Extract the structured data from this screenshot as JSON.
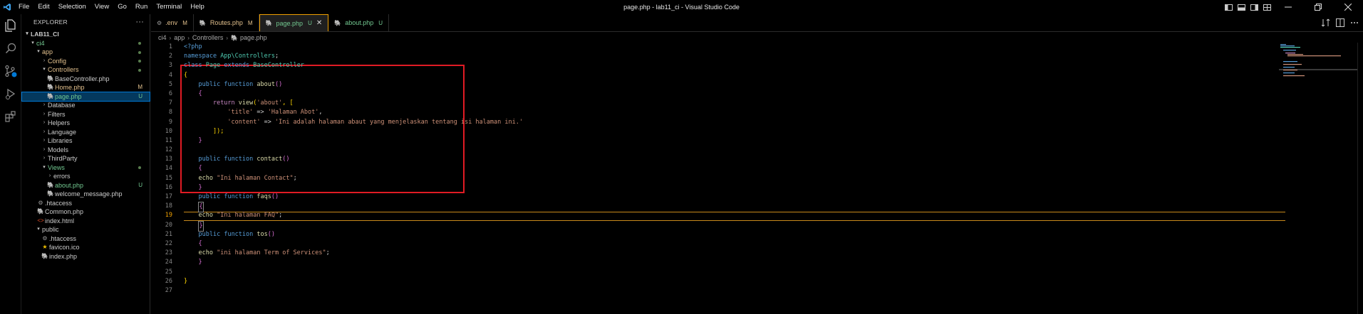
{
  "titlebar": {
    "menu": [
      "File",
      "Edit",
      "Selection",
      "View",
      "Go",
      "Run",
      "Terminal",
      "Help"
    ],
    "title": "page.php - lab11_ci - Visual Studio Code"
  },
  "explorer": {
    "header": "EXPLORER",
    "more": "···",
    "root": "LAB11_CI",
    "items": [
      {
        "label": "ci4",
        "status": "dot"
      },
      {
        "label": "app",
        "status": "dot"
      },
      {
        "label": "Config",
        "status": "dot"
      },
      {
        "label": "Controllers",
        "status": "dot"
      },
      {
        "label": "BaseController.php",
        "status": ""
      },
      {
        "label": "Home.php",
        "status": "M"
      },
      {
        "label": "page.php",
        "status": "U"
      },
      {
        "label": "Database",
        "status": ""
      },
      {
        "label": "Filters",
        "status": ""
      },
      {
        "label": "Helpers",
        "status": ""
      },
      {
        "label": "Language",
        "status": ""
      },
      {
        "label": "Libraries",
        "status": ""
      },
      {
        "label": "Models",
        "status": ""
      },
      {
        "label": "ThirdParty",
        "status": ""
      },
      {
        "label": "Views",
        "status": "dot"
      },
      {
        "label": "errors",
        "status": ""
      },
      {
        "label": "about.php",
        "status": "U"
      },
      {
        "label": "welcome_message.php",
        "status": ""
      },
      {
        "label": ".htaccess",
        "status": ""
      },
      {
        "label": "Common.php",
        "status": ""
      },
      {
        "label": "index.html",
        "status": ""
      },
      {
        "label": "public",
        "status": ""
      },
      {
        "label": ".htaccess",
        "status": ""
      },
      {
        "label": "favicon.ico",
        "status": ""
      },
      {
        "label": "index.php",
        "status": ""
      }
    ]
  },
  "tabs": [
    {
      "label": ".env",
      "status": "M"
    },
    {
      "label": "Routes.php",
      "status": "M"
    },
    {
      "label": "page.php",
      "status": "U",
      "close": "✕"
    },
    {
      "label": "about.php",
      "status": "U"
    }
  ],
  "breadcrumb": [
    "ci4",
    "app",
    "Controllers",
    "page.php"
  ],
  "editor": {
    "line_numbers": [
      "1",
      "2",
      "3",
      "4",
      "5",
      "6",
      "7",
      "8",
      "9",
      "10",
      "11",
      "12",
      "13",
      "14",
      "15",
      "16",
      "17",
      "18",
      "19",
      "20",
      "21",
      "22",
      "23",
      "24",
      "25",
      "26",
      "27"
    ],
    "tokens": {
      "l1_php": "<?php",
      "l2_ns": "namespace",
      "l2_name": "App\\Controllers",
      "l2_semi": ";",
      "l3_class": "class",
      "l3_name": "Page",
      "l3_extends": "extends",
      "l3_parent": "BaseController",
      "l4_brace": "{",
      "l5_public": "public",
      "l5_function": "function",
      "l5_name": "about",
      "l5_parens": "()",
      "l6_brace": "{",
      "l7_return": "return",
      "l7_view": "view",
      "l7_open": "(",
      "l7_arg": "'about'",
      "l7_rest": ", [",
      "l8_key": "'title'",
      "l8_arrow": " => ",
      "l8_val": "'Halaman Abot'",
      "l8_comma": ",",
      "l9_key": "'content'",
      "l9_arrow": " => ",
      "l9_val": "'Ini adalah halaman abaut yang menjelaskan tentang isi halaman ini.'",
      "l10_close": "]);",
      "l11_brace": "}",
      "l13_public": "public",
      "l13_function": "function",
      "l13_name": "contact",
      "l13_parens": "()",
      "l14_brace": "{",
      "l15_echo": "echo",
      "l15_str": "\"Ini halaman Contact\"",
      "l15_semi": ";",
      "l16_brace": "}",
      "l17_public": "public",
      "l17_function": "function",
      "l17_name": "faqs",
      "l17_parens": "()",
      "l18_brace": "{",
      "l19_echo": "echo",
      "l19_str": "\"Ini halaman FAQ\"",
      "l19_semi": ";",
      "l20_brace": "}",
      "l21_public": "public",
      "l21_function": "function",
      "l21_name": "tos",
      "l21_parens": "()",
      "l22_brace": "{",
      "l23_echo": "echo",
      "l23_str": "\"ini halaman Term of Services\"",
      "l23_semi": ";",
      "l24_brace": "}",
      "l26_brace": "}"
    }
  },
  "colors": {
    "accent_tab": "#f0a000",
    "highlight": "#e01b24",
    "git_untracked": "#73c991",
    "git_modified": "#e2c08d"
  }
}
